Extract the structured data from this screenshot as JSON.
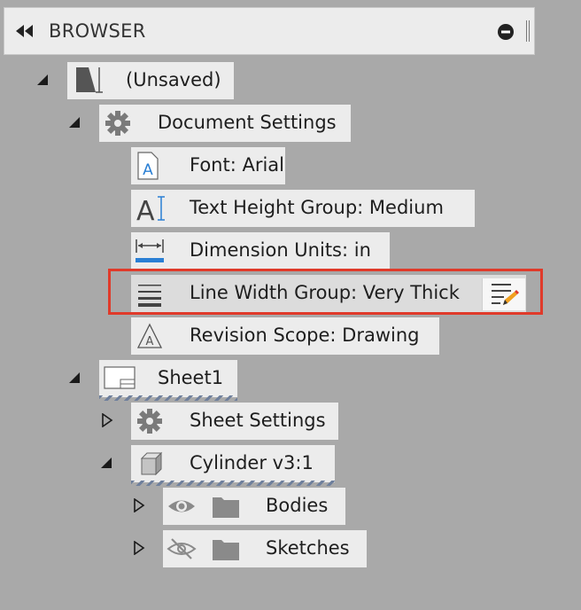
{
  "header": {
    "title": "BROWSER"
  },
  "tree": {
    "root": {
      "label": "(Unsaved)"
    },
    "document_settings": {
      "label": "Document Settings"
    },
    "font": {
      "label": "Font: Arial"
    },
    "text_height": {
      "label": "Text Height Group: Medium"
    },
    "dimension_units": {
      "label": "Dimension Units: in"
    },
    "line_width": {
      "label": "Line Width Group: Very Thick"
    },
    "revision_scope": {
      "label": "Revision Scope: Drawing"
    },
    "sheet1": {
      "label": "Sheet1"
    },
    "sheet_settings": {
      "label": "Sheet Settings"
    },
    "cylinder": {
      "label": "Cylinder v3:1"
    },
    "bodies": {
      "label": "Bodies"
    },
    "sketches": {
      "label": "Sketches"
    }
  },
  "icons": {
    "collapse": "double-left-arrow-icon",
    "panel_minus": "minus-circle-icon",
    "root": "drawing-sheet-icon",
    "settings": "gear-icon",
    "font": "font-a-icon",
    "text_height": "text-height-icon",
    "dimension": "dimension-ruler-icon",
    "line_width": "line-width-icon",
    "revision": "revision-triangle-icon",
    "sheet": "sheet-icon",
    "component": "cube-icon",
    "visible": "eye-icon",
    "hidden": "eye-slash-icon",
    "folder": "folder-icon",
    "edit": "edit-pencil-icon"
  },
  "colors": {
    "highlight_border": "#e03a2a",
    "accent_blue": "#2a7fd4"
  }
}
